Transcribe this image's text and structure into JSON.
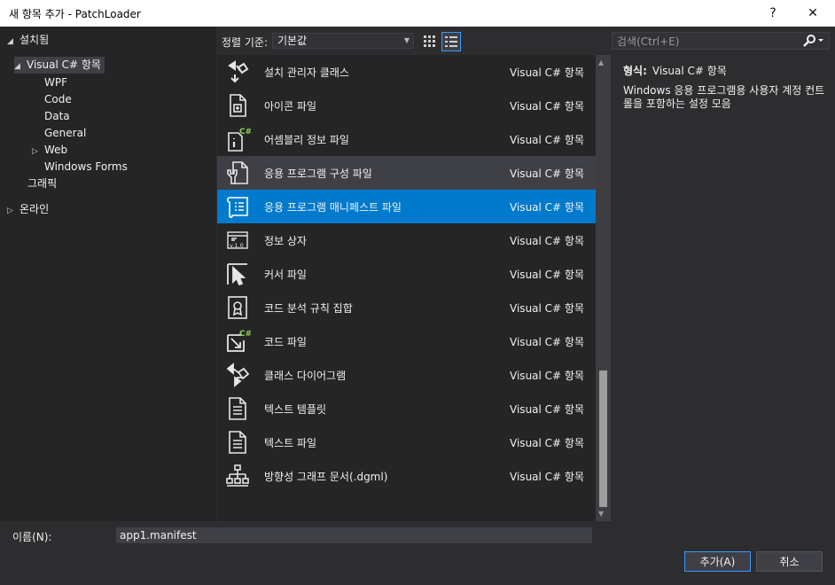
{
  "window": {
    "title": "새 항목 추가 - PatchLoader",
    "help_label": "?",
    "close_label": "✕"
  },
  "tree": {
    "installed": "설치됨",
    "visual_csharp": "Visual C# 항목",
    "children": [
      "WPF",
      "Code",
      "Data",
      "General",
      "Web",
      "Windows Forms"
    ],
    "graphics": "그래픽",
    "online": "온라인"
  },
  "toolbar": {
    "sort_label": "정렬 기준:",
    "sort_value": "기본값",
    "search_placeholder": "검색(Ctrl+E)"
  },
  "items": [
    {
      "name": "설치 관리자 클래스",
      "type": "Visual C# 항목",
      "icon": "installer-class-icon"
    },
    {
      "name": "아이콘 파일",
      "type": "Visual C# 항목",
      "icon": "icon-file-icon"
    },
    {
      "name": "어셈블리 정보 파일",
      "type": "Visual C# 항목",
      "icon": "assembly-info-icon"
    },
    {
      "name": "응용 프로그램 구성 파일",
      "type": "Visual C# 항목",
      "icon": "app-config-icon"
    },
    {
      "name": "응용 프로그램 매니페스트 파일",
      "type": "Visual C# 항목",
      "icon": "app-manifest-icon"
    },
    {
      "name": "정보 상자",
      "type": "Visual C# 항목",
      "icon": "about-box-icon"
    },
    {
      "name": "커서 파일",
      "type": "Visual C# 항목",
      "icon": "cursor-file-icon"
    },
    {
      "name": "코드 분석 규칙 집합",
      "type": "Visual C# 항목",
      "icon": "ruleset-icon"
    },
    {
      "name": "코드 파일",
      "type": "Visual C# 항목",
      "icon": "code-file-icon"
    },
    {
      "name": "클래스 다이어그램",
      "type": "Visual C# 항목",
      "icon": "class-diagram-icon"
    },
    {
      "name": "텍스트 템플릿",
      "type": "Visual C# 항목",
      "icon": "text-template-icon"
    },
    {
      "name": "텍스트 파일",
      "type": "Visual C# 항목",
      "icon": "text-file-icon"
    },
    {
      "name": "방향성 그래프 문서(.dgml)",
      "type": "Visual C# 항목",
      "icon": "dgml-icon"
    }
  ],
  "details": {
    "type_label": "형식:",
    "type_value": "Visual C# 항목",
    "description": "Windows 응용 프로그램용 사용자 계정 컨트롤을 포함하는 설정 모음"
  },
  "bottom": {
    "name_label": "이름(N):",
    "name_value": "app1.manifest",
    "add_label": "추가(A)",
    "cancel_label": "취소"
  },
  "colors": {
    "selection": "#007acc",
    "hover": "#3f3f46",
    "background": "#2d2d30",
    "panel": "#252526"
  }
}
